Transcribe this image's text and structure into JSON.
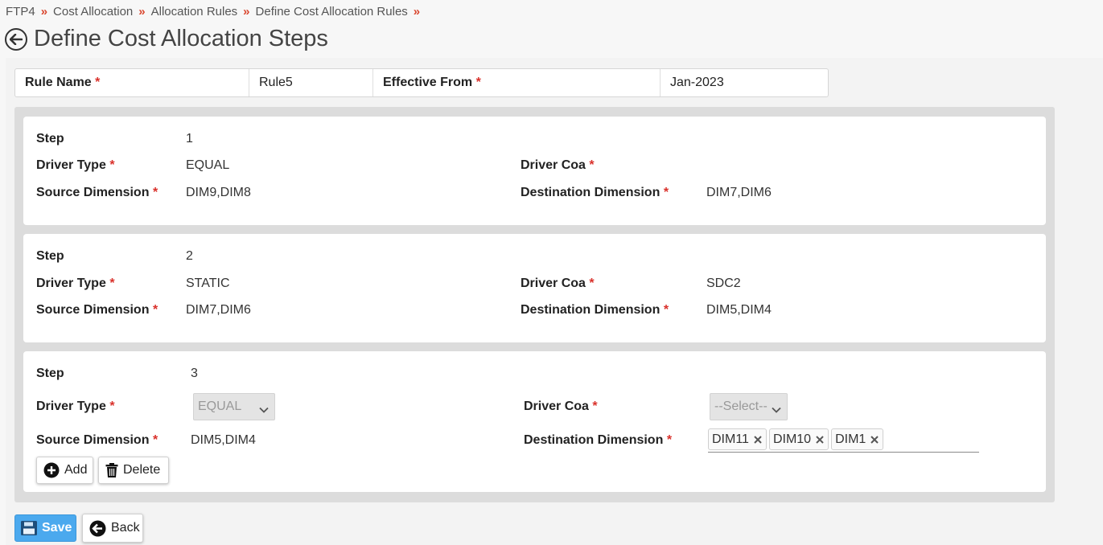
{
  "breadcrumb": [
    "FTP4",
    "Cost Allocation",
    "Allocation Rules",
    "Define Cost Allocation Rules"
  ],
  "page_title": "Define Cost Allocation Steps",
  "rule": {
    "name_label": "Rule Name",
    "name_value": "Rule5",
    "effective_label": "Effective From",
    "effective_value": "Jan-2023"
  },
  "required_mark": "*",
  "labels": {
    "step": "Step",
    "driver_type": "Driver Type",
    "driver_coa": "Driver Coa",
    "source_dimension": "Source Dimension",
    "destination_dimension": "Destination Dimension"
  },
  "steps": [
    {
      "step": "1",
      "driver_type": "EQUAL",
      "driver_coa": "",
      "source": "DIM9,DIM8",
      "destination": "DIM7,DIM6"
    },
    {
      "step": "2",
      "driver_type": "STATIC",
      "driver_coa": "SDC2",
      "source": "DIM7,DIM6",
      "destination": "DIM5,DIM4"
    },
    {
      "step": "3",
      "driver_type": "EQUAL",
      "driver_coa": "--Select--",
      "source": "DIM5,DIM4",
      "destination_tags": [
        "DIM11",
        "DIM10",
        "DIM1"
      ]
    }
  ],
  "buttons": {
    "add": "Add",
    "delete": "Delete",
    "save": "Save",
    "back": "Back"
  },
  "colors": {
    "accent": "#4ba9ee",
    "required": "#d9302a",
    "breadcrumb_sep": "#d9462e"
  }
}
